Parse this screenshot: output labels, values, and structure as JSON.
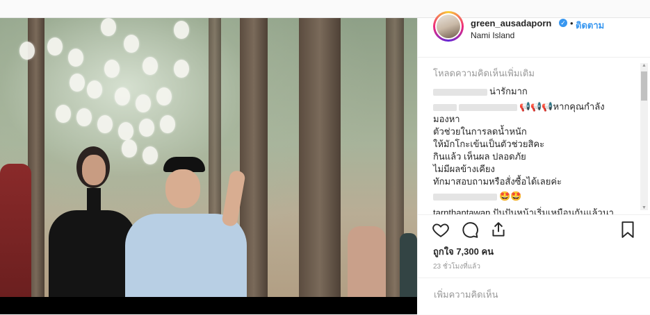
{
  "post": {
    "username": "green_ausadaporn",
    "verified_icon": "verified-badge-icon",
    "separator": "•",
    "follow_label": "ติดตาม",
    "location": "Nami Island",
    "load_more": "โหลดความคิดเห็นเพิ่มเติม",
    "comments": [
      {
        "text": "น่ารักมาก"
      },
      {
        "text": "📢📢📢หากคุณกำลัง\nมองหา\nตัวช่วยในการลดน้ำหนัก\nให้มักโกะเข้นเป็นตัวช่วยสิคะ\nกินแล้ว เห็นผล ปลอดภัย\nไม่มีผลข้างเคียง\nทักมาสอบถามหรือสั่งซื้อได้เลยค่ะ"
      },
      {
        "text": "🤩🤩"
      },
      {
        "text": "tarnthantawan ปันปันหน้าเริ่มเหมือนกันแล้วนา"
      }
    ],
    "likes": "ถูกใจ 7,300 คน",
    "timestamp": "23 ชั่วโมงที่แล้ว",
    "add_comment_placeholder": "เพิ่มความคิดเห็น",
    "accent_color": "#3897f0"
  }
}
